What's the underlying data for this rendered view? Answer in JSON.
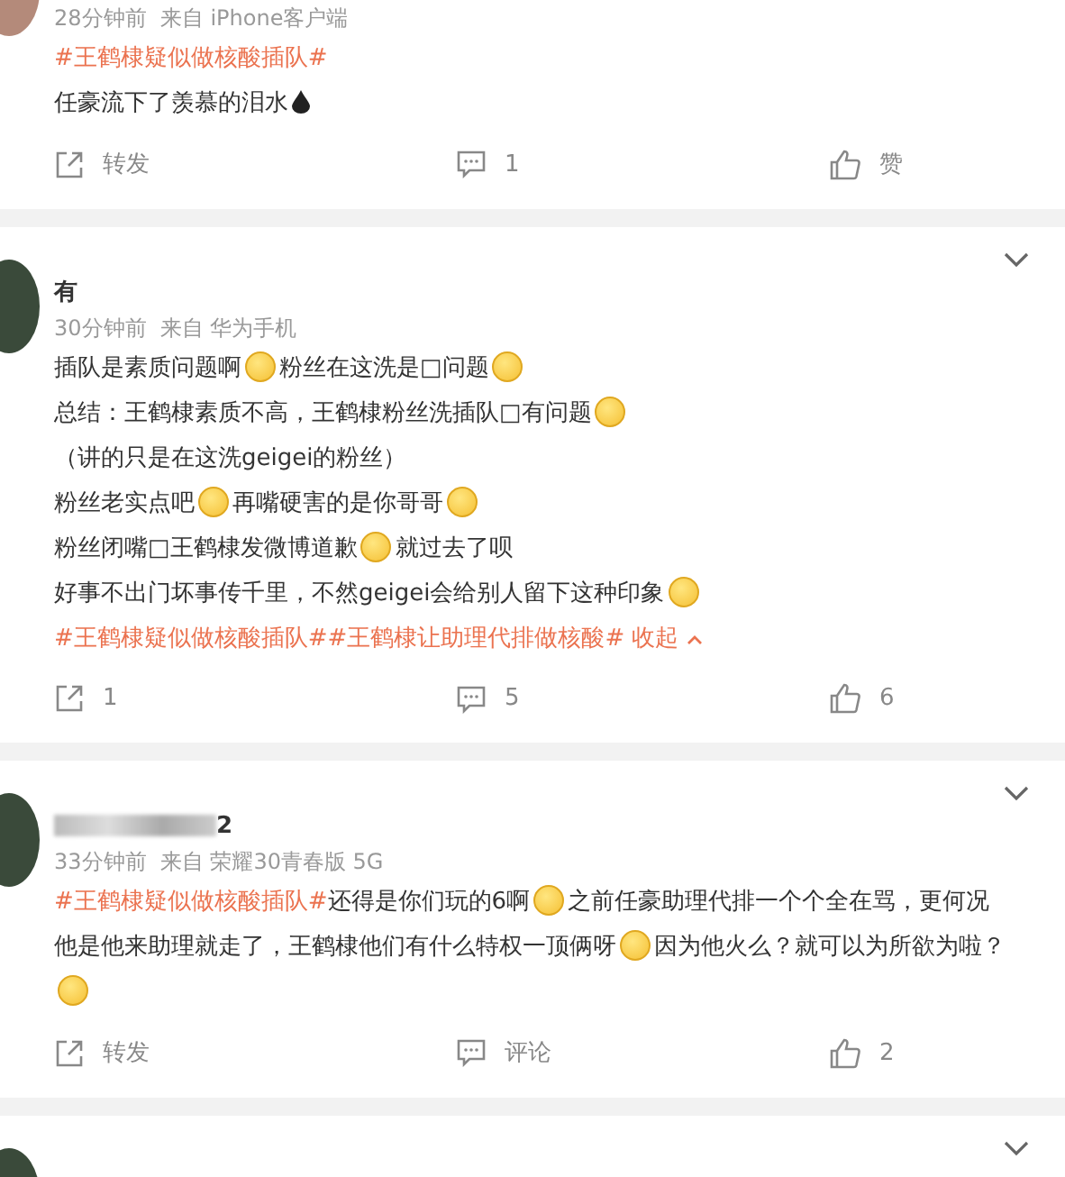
{
  "posts": [
    {
      "menu_button": false,
      "meta": "28分钟前  来自 iPhone客户端",
      "lines": [
        [
          {
            "kind": "topic",
            "text": "#王鹤棣疑似做核酸插队#"
          }
        ],
        [
          {
            "kind": "text",
            "text": "任豪流下了羡慕的泪水"
          },
          {
            "kind": "drop"
          }
        ]
      ],
      "actions": {
        "repost": "转发",
        "comment": "1",
        "like": "赞"
      }
    },
    {
      "name": "有",
      "menu_button": true,
      "meta": "30分钟前  来自 华为手机",
      "lines": [
        [
          {
            "kind": "text",
            "text": "插队是素质问题啊"
          },
          {
            "kind": "emoji"
          },
          {
            "kind": "text",
            "text": "粉丝在这洗是□问题"
          },
          {
            "kind": "emoji"
          }
        ],
        [
          {
            "kind": "text",
            "text": "总结：王鹤棣素质不高，王鹤棣粉丝洗插队□有问题"
          },
          {
            "kind": "emoji"
          }
        ],
        [
          {
            "kind": "text",
            "text": "（讲的只是在这洗geigei的粉丝）"
          }
        ],
        [
          {
            "kind": "text",
            "text": "粉丝老实点吧"
          },
          {
            "kind": "emoji"
          },
          {
            "kind": "text",
            "text": "再嘴硬害的是你哥哥"
          },
          {
            "kind": "emoji"
          }
        ],
        [
          {
            "kind": "text",
            "text": "粉丝闭嘴□王鹤棣发微博道歉"
          },
          {
            "kind": "emoji"
          },
          {
            "kind": "text",
            "text": "就过去了呗"
          }
        ],
        [
          {
            "kind": "text",
            "text": "好事不出门坏事传千里，不然geigei会给别人留下这种印象"
          },
          {
            "kind": "emoji"
          }
        ],
        [
          {
            "kind": "topic",
            "text": "#王鹤棣疑似做核酸插队#"
          },
          {
            "kind": "topic",
            "text": "#王鹤棣让助理代排做核酸#"
          },
          {
            "kind": "collapse",
            "text": "收起"
          }
        ]
      ],
      "actions": {
        "repost": "1",
        "comment": "5",
        "like": "6"
      }
    },
    {
      "name": "2",
      "name_redacted": true,
      "menu_button": true,
      "meta": "33分钟前  来自 荣耀30青春版 5G",
      "lines": [
        [
          {
            "kind": "topic",
            "text": "#王鹤棣疑似做核酸插队#"
          },
          {
            "kind": "text",
            "text": "还得是你们玩的6啊"
          },
          {
            "kind": "emoji"
          },
          {
            "kind": "text",
            "text": "之前任豪助理代排一个个全在骂，更何况他是他来助理就走了，王鹤棣他们有什么特权一顶俩呀"
          },
          {
            "kind": "emoji"
          },
          {
            "kind": "text",
            "text": "因为他火么？就可以为所欲为啦？"
          },
          {
            "kind": "emoji"
          }
        ]
      ],
      "actions": {
        "repost": "转发",
        "comment": "评论",
        "like": "2"
      }
    },
    {
      "menu_button": true
    }
  ]
}
